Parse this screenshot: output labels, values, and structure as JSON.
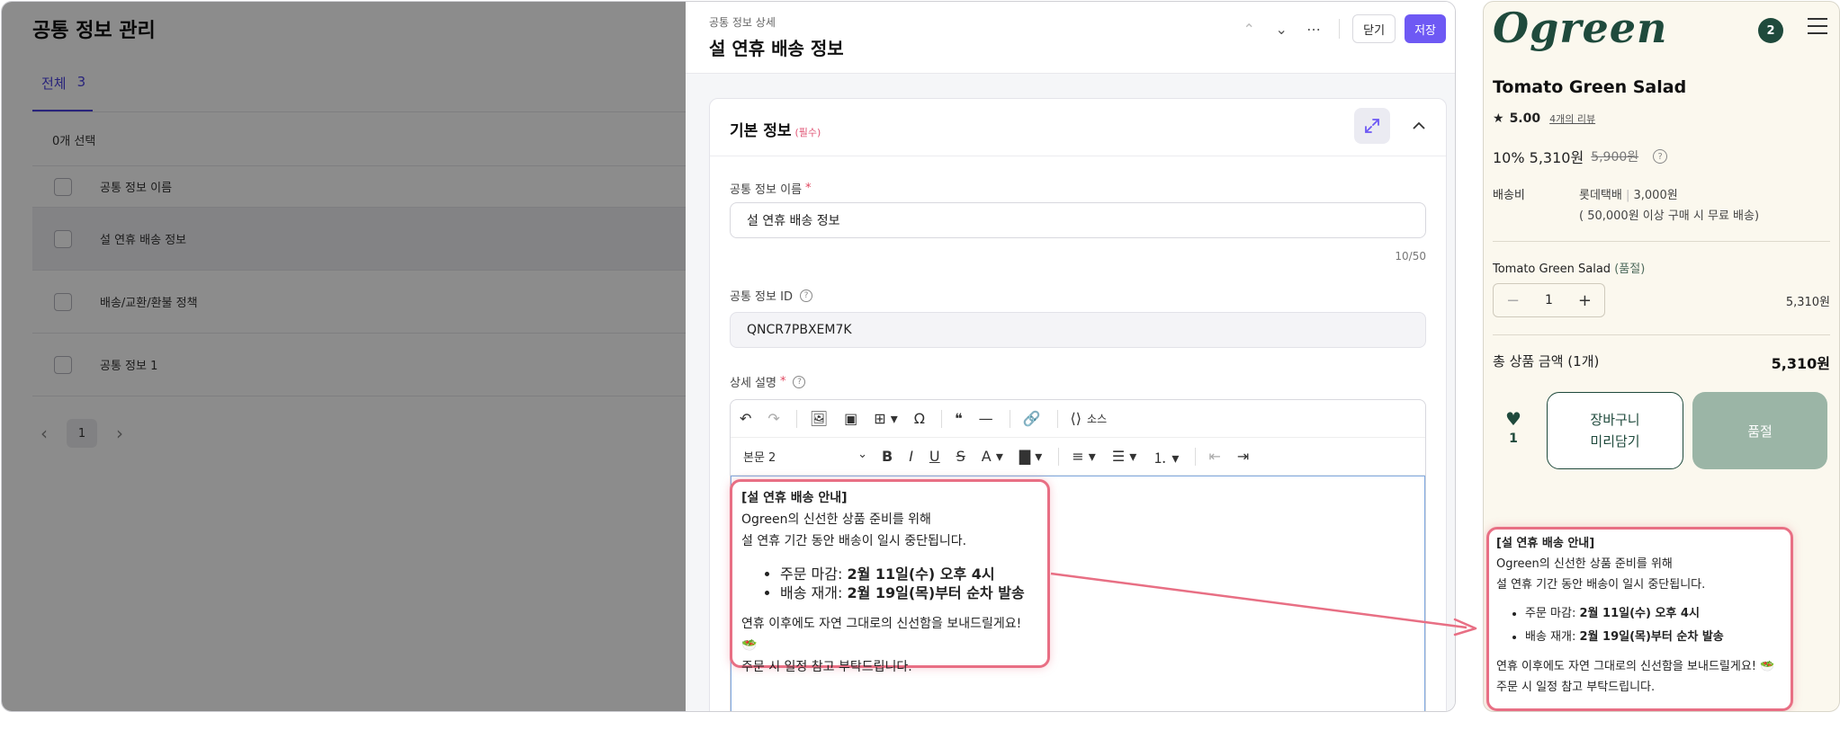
{
  "list": {
    "title": "공통 정보 관리",
    "tab_label": "전체",
    "tab_count": "3",
    "selected_count": "0개 선택",
    "column_header": "공통 정보 이름",
    "rows": [
      "설 연휴 배송 정보",
      "배송/교환/환불 정책",
      "공통 정보 1"
    ],
    "page": "1"
  },
  "detail": {
    "subtitle": "공통 정보 상세",
    "title": "설 연휴 배송 정보",
    "close_label": "닫기",
    "save_label": "저장",
    "section_title": "기본 정보",
    "section_required": "(필수)",
    "name_label": "공통 정보 이름",
    "name_value": "설 연휴 배송 정보",
    "name_counter": "10/50",
    "id_label": "공통 정보 ID",
    "id_value": "QNCR7PBXEM7K",
    "desc_label": "상세 설명",
    "editor_style": "본문 2",
    "source_label": "소스"
  },
  "notice": {
    "title": "[설 연휴 배송 안내]",
    "line1": "Ogreen의 신선한 상품 준비를 위해",
    "line2": "설 연휴 기간 동안 배송이 일시 중단됩니다.",
    "order_deadline_label": "주문 마감: ",
    "order_deadline_value": "2월 11일(수) 오후 4시",
    "resume_label": "배송 재개: ",
    "resume_value": "2월 19일(목)부터 순차 발송",
    "line3": "연휴 이후에도 자연 그대로의 신선함을 보내드릴게요! 🥗",
    "line4": "주문 시 일정 참고 부탁드립니다."
  },
  "mobile": {
    "logo": "Ogreen",
    "cart_count": "2",
    "product_name": "Tomato Green Salad",
    "rating": "5.00",
    "review_link": "4개의 리뷰",
    "discount": "10% 5,310원",
    "original_price": "5,900원",
    "shipping_label": "배송비",
    "shipping_carrier": "롯데택배",
    "shipping_fee": "3,000원",
    "shipping_free_note": "( 50,000원 이상 구매 시 무료 배송)",
    "option_name": "Tomato Green Salad",
    "option_status": "(품절)",
    "quantity": "1",
    "option_price": "5,310원",
    "total_label": "총 상품 금액 (1개)",
    "total_value": "5,310원",
    "like_count": "1",
    "cart_button_line1": "장바구니",
    "cart_button_line2": "미리담기",
    "sold_out_label": "품절"
  },
  "colors": {
    "accent": "#6e59f4",
    "brand_green": "#1f4a3c",
    "highlight": "#e86f84"
  },
  "icons": [
    "undo-icon",
    "redo-icon",
    "image-icon",
    "video-icon",
    "table-icon",
    "omega-icon",
    "quote-icon",
    "hr-icon",
    "link-icon",
    "source-icon",
    "bold-icon",
    "italic-icon",
    "underline-icon",
    "strike-icon",
    "font-color-icon",
    "bg-color-icon",
    "align-icon",
    "bullet-list-icon",
    "numbered-list-icon",
    "outdent-icon",
    "indent-icon",
    "expand-icon",
    "chevron-up-icon",
    "chevron-down-icon",
    "more-icon",
    "star-icon",
    "heart-icon",
    "menu-icon"
  ]
}
